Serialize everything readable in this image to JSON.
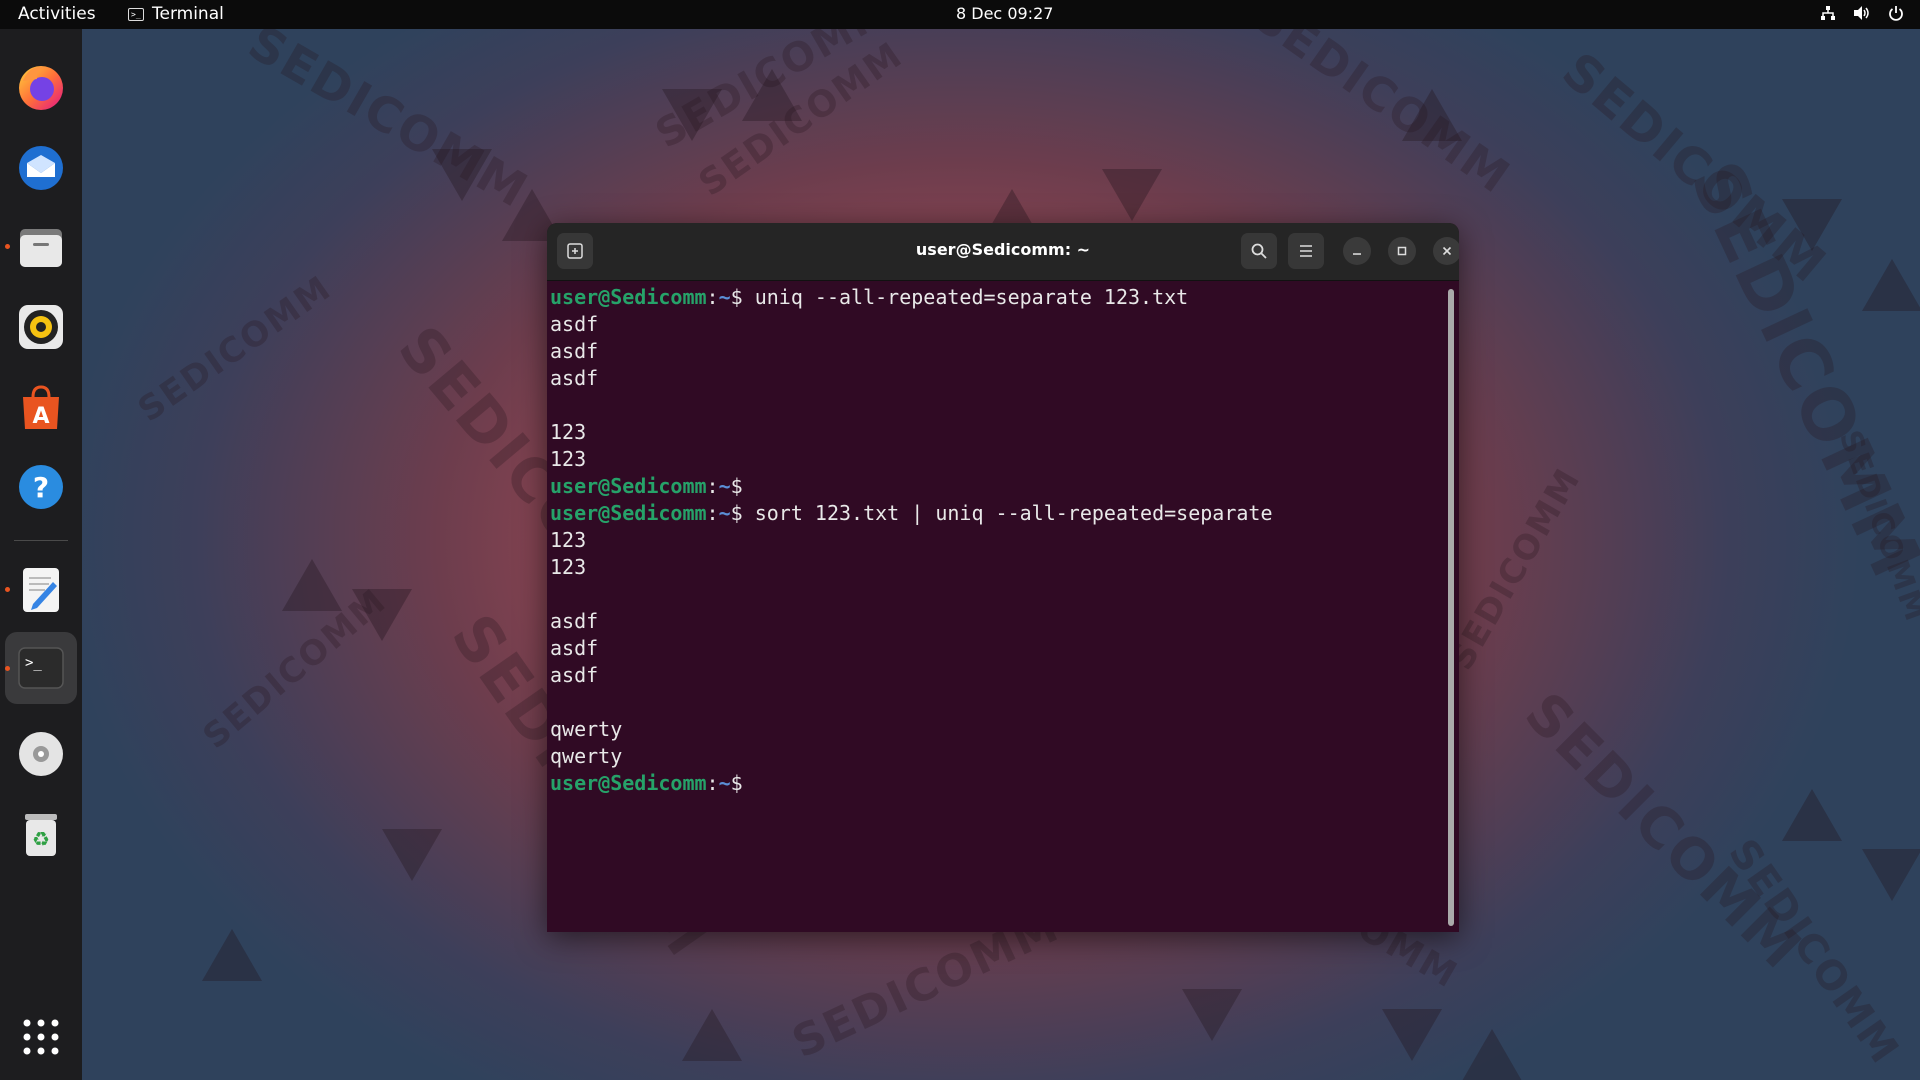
{
  "topbar": {
    "activities": "Activities",
    "app_name": "Terminal",
    "clock": "8 Dec  09:27"
  },
  "wallpaper": {
    "brand": "SEDICOMM"
  },
  "dock": {
    "items": [
      {
        "name": "firefox-icon"
      },
      {
        "name": "thunderbird-icon"
      },
      {
        "name": "files-icon"
      },
      {
        "name": "rhythmbox-icon"
      },
      {
        "name": "app-center-icon"
      },
      {
        "name": "help-icon"
      },
      {
        "name": "text-editor-icon"
      },
      {
        "name": "terminal-icon"
      },
      {
        "name": "disc-icon"
      },
      {
        "name": "trash-icon"
      },
      {
        "name": "show-apps-icon"
      }
    ]
  },
  "window": {
    "title": "user@Sedicomm: ~",
    "accent": "#300a24"
  },
  "terminal": {
    "prompt_user": "user@Sedicomm",
    "prompt_path": "~",
    "lines": [
      {
        "type": "prompt",
        "cmd": " uniq --all-repeated=separate 123.txt"
      },
      {
        "type": "out",
        "text": "asdf"
      },
      {
        "type": "out",
        "text": "asdf"
      },
      {
        "type": "out",
        "text": "asdf"
      },
      {
        "type": "out",
        "text": ""
      },
      {
        "type": "out",
        "text": "123"
      },
      {
        "type": "out",
        "text": "123"
      },
      {
        "type": "prompt",
        "cmd": ""
      },
      {
        "type": "prompt",
        "cmd": " sort 123.txt | uniq --all-repeated=separate"
      },
      {
        "type": "out",
        "text": "123"
      },
      {
        "type": "out",
        "text": "123"
      },
      {
        "type": "out",
        "text": ""
      },
      {
        "type": "out",
        "text": "asdf"
      },
      {
        "type": "out",
        "text": "asdf"
      },
      {
        "type": "out",
        "text": "asdf"
      },
      {
        "type": "out",
        "text": ""
      },
      {
        "type": "out",
        "text": "qwerty"
      },
      {
        "type": "out",
        "text": "qwerty"
      },
      {
        "type": "prompt",
        "cmd": ""
      }
    ]
  }
}
